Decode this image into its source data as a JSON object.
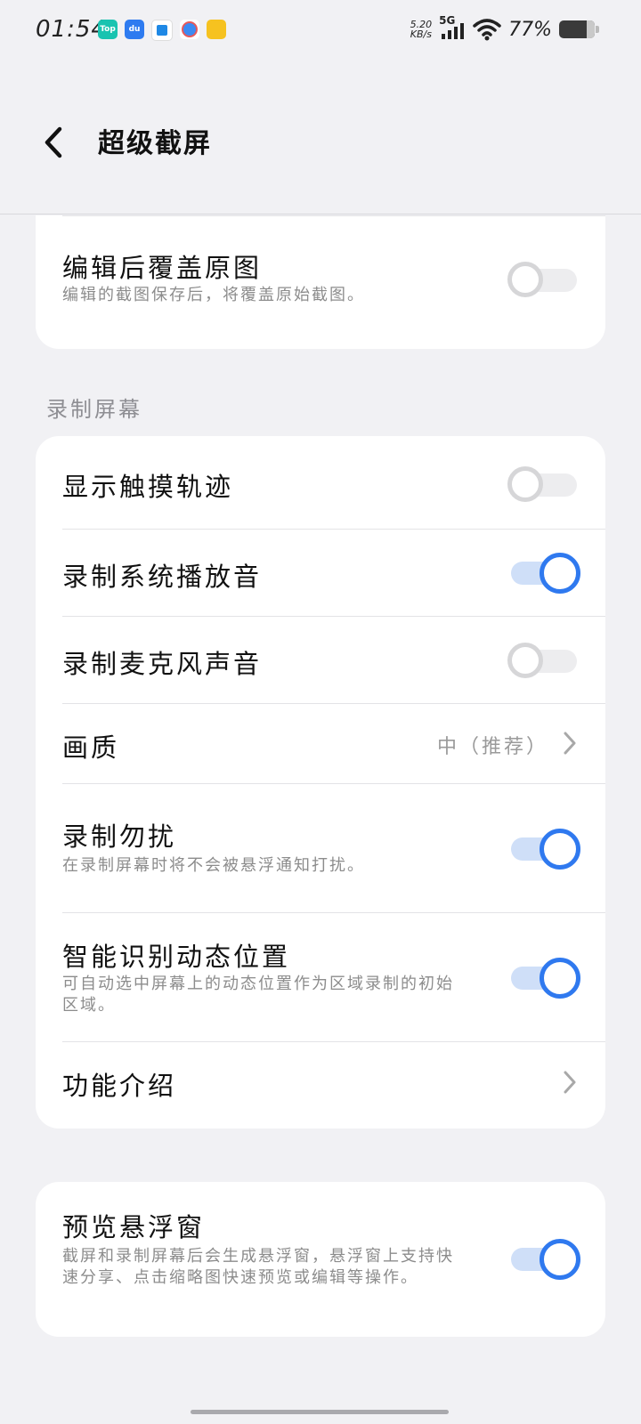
{
  "status": {
    "time": "01:54",
    "apps": [
      {
        "icon": "top-app-icon",
        "label": "Top",
        "color": "#19c3b0"
      },
      {
        "icon": "du-app-icon",
        "label": "du",
        "color": "#2e7bf0"
      },
      {
        "icon": "blue-app-icon",
        "label": "",
        "color": "#1e88e5"
      },
      {
        "icon": "map-app-icon",
        "label": "",
        "color": "#3d8bf2"
      },
      {
        "icon": "yellow-app-icon",
        "label": "",
        "color": "#f6c220"
      }
    ],
    "speed_value": "5.20",
    "speed_unit": "KB/s",
    "network": "5G",
    "battery": "77%"
  },
  "header": {
    "title": "超级截屏"
  },
  "card1": {
    "overwrite": {
      "title": "编辑后覆盖原图",
      "subtitle": "编辑的截图保存后，将覆盖原始截图。",
      "enabled": false
    }
  },
  "section": {
    "record_label": "录制屏幕"
  },
  "card2": {
    "touch": {
      "title": "显示触摸轨迹",
      "enabled": false
    },
    "system_audio": {
      "title": "录制系统播放音",
      "enabled": true
    },
    "mic": {
      "title": "录制麦克风声音",
      "enabled": false
    },
    "quality": {
      "title": "画质",
      "value": "中（推荐）"
    },
    "dnd": {
      "title": "录制勿扰",
      "subtitle": "在录制屏幕时将不会被悬浮通知打扰。",
      "enabled": true
    },
    "smart": {
      "title": "智能识别动态位置",
      "subtitle": "可自动选中屏幕上的动态位置作为区域录制的初始区域。",
      "enabled": true
    },
    "intro": {
      "title": "功能介绍"
    }
  },
  "card3": {
    "preview": {
      "title": "预览悬浮窗",
      "subtitle": "截屏和录制屏幕后会生成悬浮窗，悬浮窗上支持快速分享、点击缩略图快速预览或编辑等操作。",
      "enabled": true
    }
  },
  "colors": {
    "accent": "#2f79ef",
    "background": "#f1f1f4"
  }
}
